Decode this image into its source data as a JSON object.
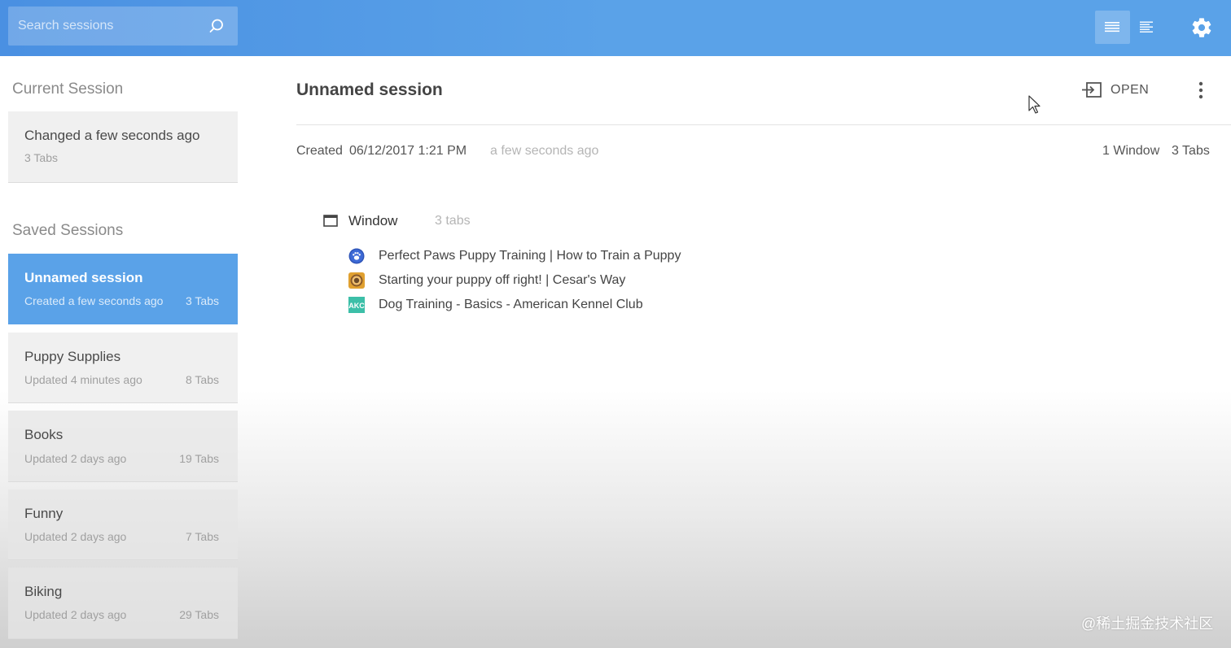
{
  "search": {
    "placeholder": "Search sessions"
  },
  "header": {
    "icons": [
      "search-icon",
      "list-view-icon",
      "detail-view-icon",
      "gear-icon"
    ]
  },
  "sidebar": {
    "current_title": "Current Session",
    "current": {
      "title": "Changed a few seconds ago",
      "tabs": "3 Tabs"
    },
    "saved_title": "Saved Sessions",
    "saved": [
      {
        "title": "Unnamed session",
        "sub": "Created a few seconds ago",
        "tabs": "3 Tabs"
      },
      {
        "title": "Puppy Supplies",
        "sub": "Updated 4 minutes ago",
        "tabs": "8 Tabs"
      },
      {
        "title": "Books",
        "sub": "Updated 2 days ago",
        "tabs": "19 Tabs"
      },
      {
        "title": "Funny",
        "sub": "Updated 2 days ago",
        "tabs": "7 Tabs"
      },
      {
        "title": "Biking",
        "sub": "Updated 2 days ago",
        "tabs": "29 Tabs"
      }
    ]
  },
  "main": {
    "title": "Unnamed session",
    "open_label": "OPEN",
    "created_label": "Created",
    "created_date": "06/12/2017 1:21 PM",
    "created_relative": "a few seconds ago",
    "window_count": "1 Window",
    "tab_count": "3 Tabs",
    "window": {
      "label": "Window",
      "count": "3 tabs",
      "tabs": [
        {
          "title": "Perfect Paws Puppy Training | How to Train a Puppy",
          "icon": "paw-favicon"
        },
        {
          "title": "Starting your puppy off right! | Cesar's Way",
          "icon": "cesar-favicon"
        },
        {
          "title": "Dog Training - Basics - American Kennel Club",
          "icon": "akc-favicon",
          "icon_text": "AKC"
        }
      ]
    }
  },
  "watermark": "@稀土掘金技术社区",
  "colors": {
    "accent": "#5aa2e8",
    "topbar": "#4a90e2"
  }
}
